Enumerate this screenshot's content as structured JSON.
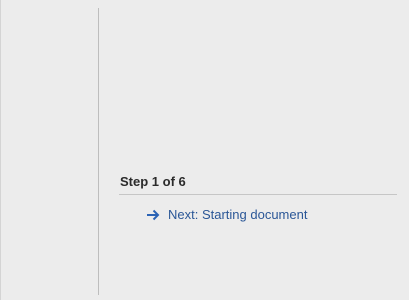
{
  "mail_merge_pane": {
    "step_label": "Step 1 of 6",
    "next_link": {
      "label": "Next: Starting document",
      "icon": "right-arrow-icon"
    }
  },
  "colors": {
    "pane_background": "#ececec",
    "link": "#2b5797",
    "arrow": "#2b63b5"
  }
}
